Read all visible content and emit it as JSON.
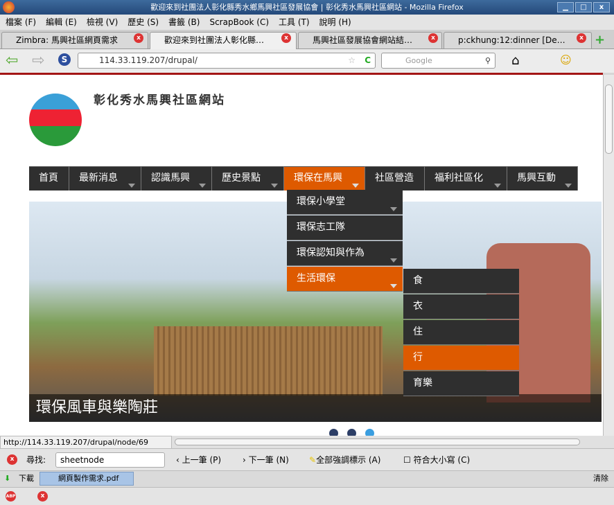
{
  "window": {
    "title": "歡迎來到社團法人彰化縣秀水鄉馬興社區發展協會 | 彰化秀水馬興社區網站 - Mozilla Firefox",
    "min": "▁",
    "max": "□",
    "close": "x"
  },
  "menubar": [
    "檔案 (F)",
    "編輯 (E)",
    "檢視 (V)",
    "歷史 (S)",
    "書籤 (B)",
    "ScrapBook (C)",
    "工具 (T)",
    "說明 (H)"
  ],
  "tabs": [
    {
      "label": "Zimbra: 馬興社區網頁需求",
      "active": false
    },
    {
      "label": "歡迎來到社團法人彰化縣…",
      "active": true
    },
    {
      "label": "馬興社區發展協會網站結…",
      "active": false
    },
    {
      "label": "p:ckhung:12:dinner [De…",
      "active": false
    }
  ],
  "navbar": {
    "url": "114.33.119.207/drupal/",
    "search_placeholder": "Google"
  },
  "site": {
    "title": "彰化秀水馬興社區網站",
    "accent": "#de5a00",
    "menu_bg": "#2f2f2f"
  },
  "main_menu": [
    {
      "label": "首頁",
      "arrow": false
    },
    {
      "label": "最新消息",
      "arrow": true
    },
    {
      "label": "認識馬興",
      "arrow": true
    },
    {
      "label": "歷史景點",
      "arrow": true
    },
    {
      "label": "環保在馬興",
      "arrow": true,
      "active": true
    },
    {
      "label": "社區營造",
      "arrow": false
    },
    {
      "label": "福利社區化",
      "arrow": true
    },
    {
      "label": "馬興互動",
      "arrow": true
    }
  ],
  "dropdown": [
    {
      "label": "環保小學堂",
      "arrow": true
    },
    {
      "label": "環保志工隊",
      "arrow": false
    },
    {
      "label": "環保認知與作為",
      "arrow": true
    },
    {
      "label": "生活環保",
      "arrow": true,
      "active": true
    }
  ],
  "submenu": [
    {
      "label": "食"
    },
    {
      "label": "衣"
    },
    {
      "label": "住"
    },
    {
      "label": "行",
      "active": true
    },
    {
      "label": "育樂"
    }
  ],
  "slideshow": {
    "caption": "環保風車與樂陶莊",
    "slides": 3,
    "current": 3
  },
  "status": {
    "url": "http://114.33.119.207/drupal/node/69"
  },
  "findbar": {
    "label": "尋找:",
    "value": "sheetnode",
    "prev": "上一筆 (P)",
    "next": "下一筆 (N)",
    "highlight": "全部強調標示 (A)",
    "match_case": "符合大小寫 (C)"
  },
  "downloads": {
    "label": "下載",
    "file": "網頁製作需求.pdf",
    "clear": "清除"
  },
  "addon": {
    "abp": "ABP"
  }
}
